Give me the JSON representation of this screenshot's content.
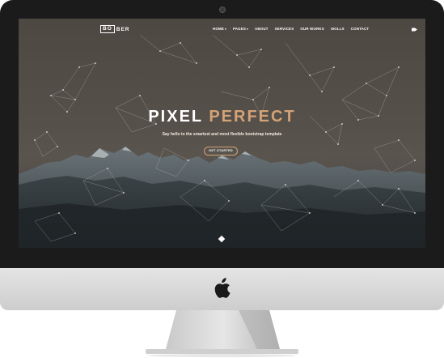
{
  "site": {
    "logo": {
      "boxed": "BO",
      "rest": "BER"
    },
    "nav": [
      {
        "label": "HOME",
        "dropdown": true
      },
      {
        "label": "PAGES",
        "dropdown": true
      },
      {
        "label": "ABOUT",
        "dropdown": false
      },
      {
        "label": "SERVICES",
        "dropdown": false
      },
      {
        "label": "OUR WORKS",
        "dropdown": false
      },
      {
        "label": "SKILLS",
        "dropdown": false
      },
      {
        "label": "CONTACT",
        "dropdown": false
      }
    ],
    "hero": {
      "title_main": "PIXEL ",
      "title_accent": "PERFECT",
      "subtitle": "Say hello to the smartest and most flexible bootstrap template",
      "cta": "GET STARTED"
    }
  },
  "colors": {
    "accent": "#d3a277",
    "bezel": "#1b1b1b",
    "chin": "#d9d9d9"
  },
  "icons": {
    "menu_toggle": "menu-toggle-icon",
    "scroll": "scroll-down-icon",
    "brand": "apple-logo-icon",
    "camera": "camera-icon"
  }
}
